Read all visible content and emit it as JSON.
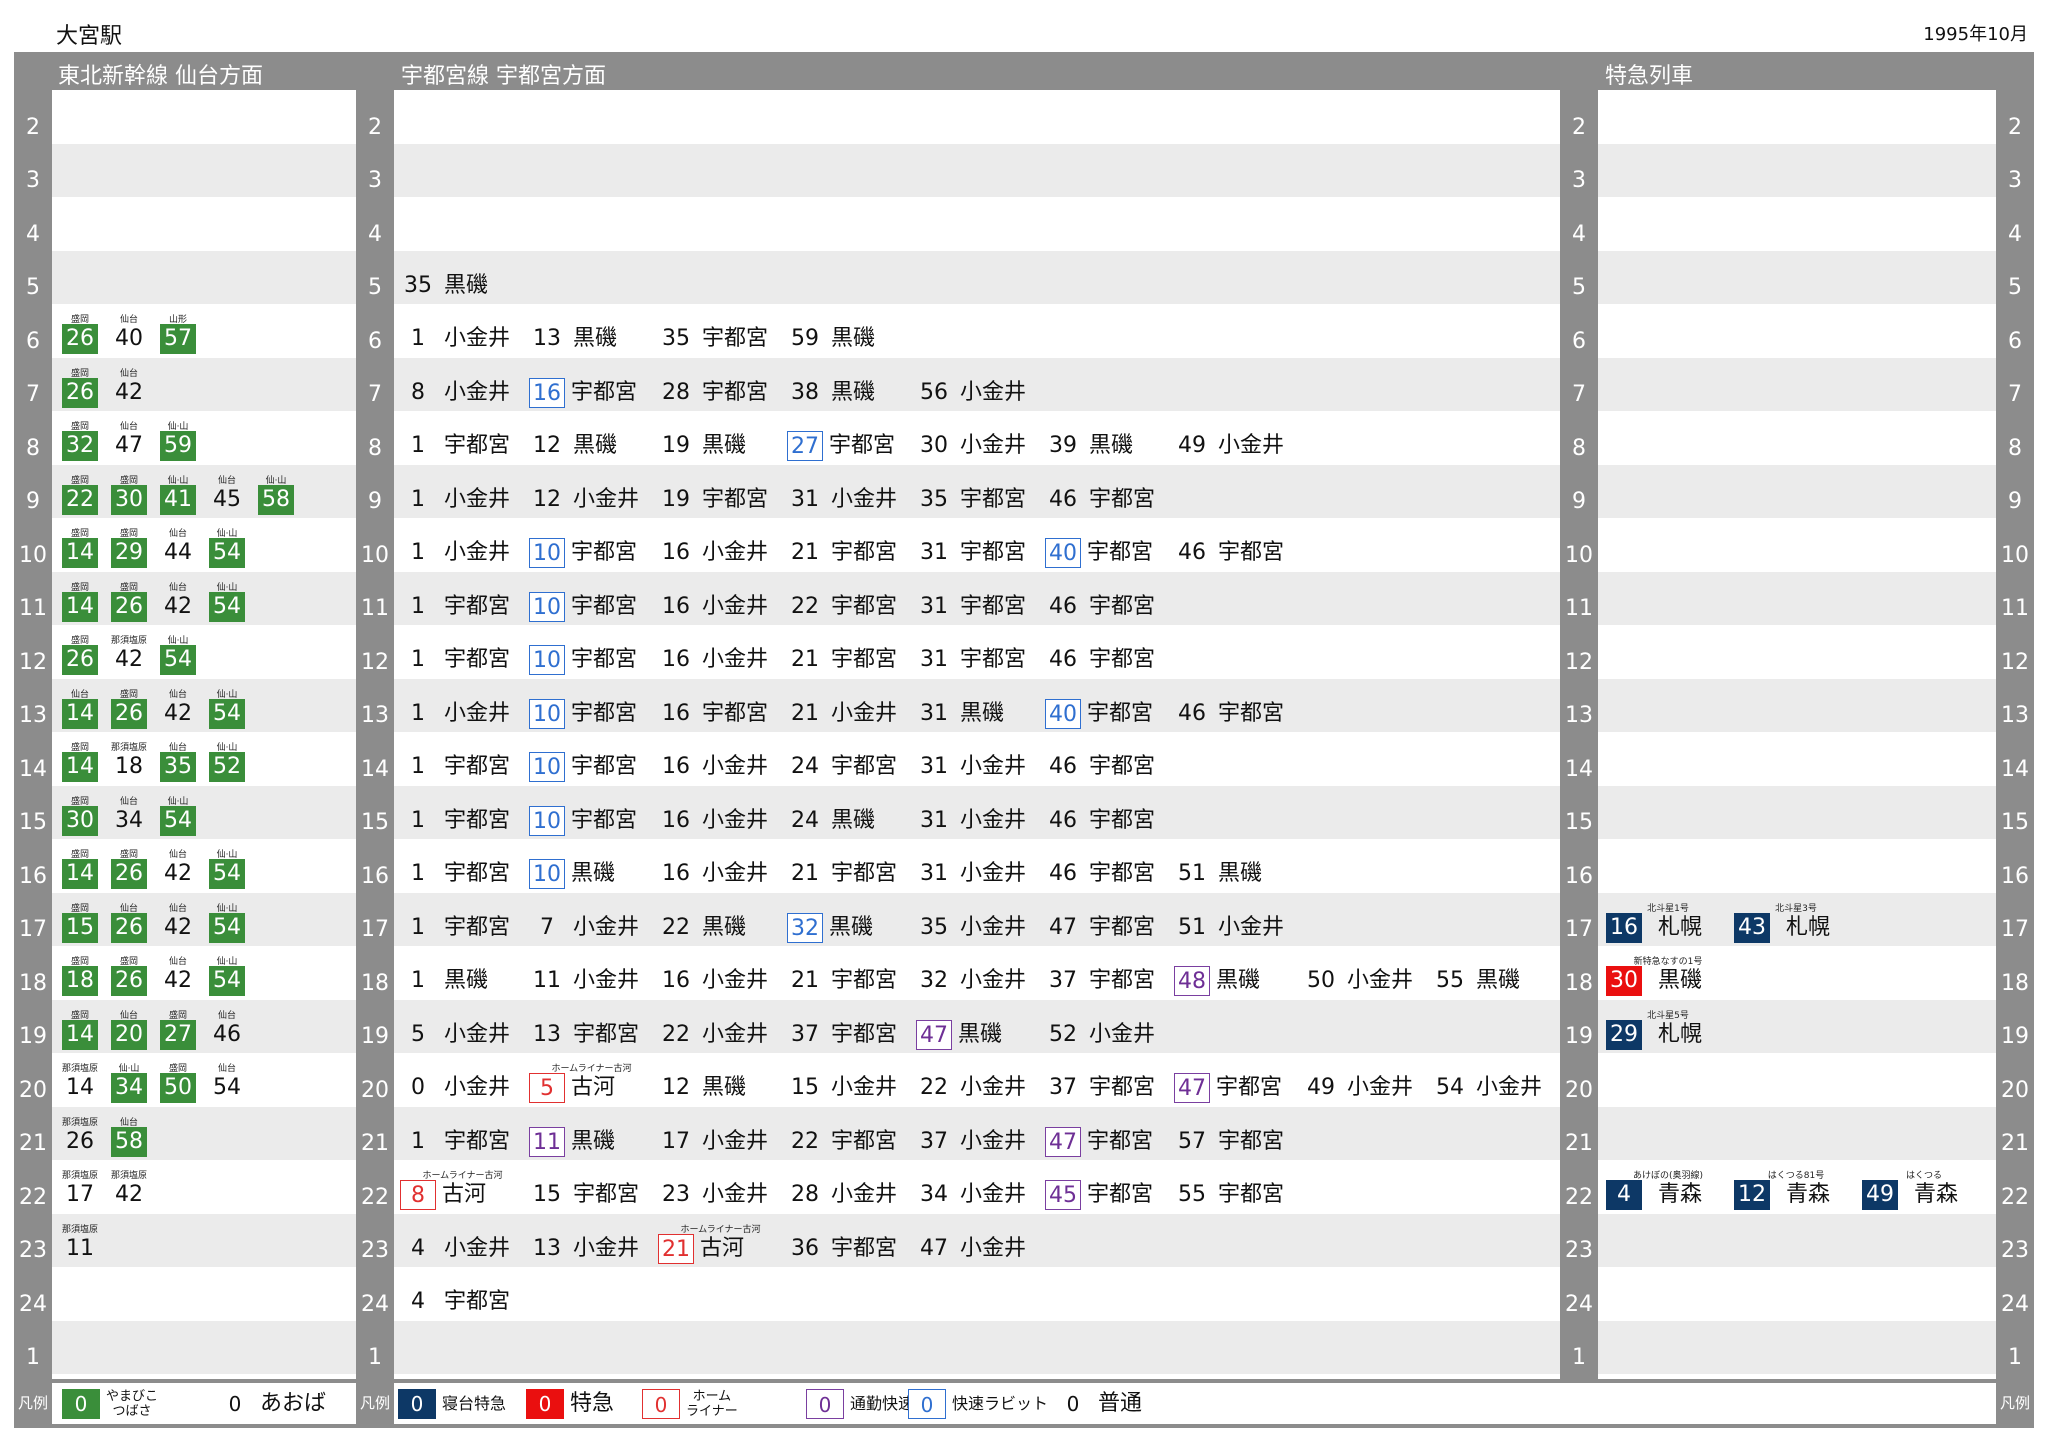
{
  "station": "大宮駅",
  "date": "1995年10月",
  "sections": {
    "shinkansen": "東北新幹線 仙台方面",
    "utsunomiya": "宇都宮線 宇都宮方面",
    "express": "特急列車"
  },
  "hours": [
    "2",
    "3",
    "4",
    "5",
    "6",
    "7",
    "8",
    "9",
    "10",
    "11",
    "12",
    "13",
    "14",
    "15",
    "16",
    "17",
    "18",
    "19",
    "20",
    "21",
    "22",
    "23",
    "24",
    "1"
  ],
  "legend": {
    "label": "凡例",
    "shinkansen": [
      {
        "min": "0",
        "style": "green",
        "text": "やまびこ\nつばさ"
      },
      {
        "min": "0",
        "style": "plain",
        "text": "あおば"
      }
    ],
    "utsunomiya": [
      {
        "min": "0",
        "style": "navy",
        "text": "寝台特急"
      },
      {
        "min": "0",
        "style": "red",
        "text": "特急"
      },
      {
        "min": "0",
        "style": "redo",
        "text": "ホーム\nライナー"
      },
      {
        "min": "0",
        "style": "purple",
        "text": "通勤快速"
      },
      {
        "min": "0",
        "style": "blue",
        "text": "快速ラビット"
      },
      {
        "min": "0",
        "style": "plain",
        "text": "普通"
      }
    ]
  },
  "shinkansen_rows": [
    [],
    [],
    [],
    [],
    [
      {
        "m": "26",
        "s": "green",
        "n": "盛岡"
      },
      {
        "m": "40",
        "s": "plain",
        "n": "仙台"
      },
      {
        "m": "57",
        "s": "green",
        "n": "山形"
      }
    ],
    [
      {
        "m": "26",
        "s": "green",
        "n": "盛岡"
      },
      {
        "m": "42",
        "s": "plain",
        "n": "仙台"
      }
    ],
    [
      {
        "m": "32",
        "s": "green",
        "n": "盛岡"
      },
      {
        "m": "47",
        "s": "plain",
        "n": "仙台"
      },
      {
        "m": "59",
        "s": "green",
        "n": "仙·山"
      }
    ],
    [
      {
        "m": "22",
        "s": "green",
        "n": "盛岡"
      },
      {
        "m": "30",
        "s": "green",
        "n": "盛岡"
      },
      {
        "m": "41",
        "s": "green",
        "n": "仙·山"
      },
      {
        "m": "45",
        "s": "plain",
        "n": "仙台"
      },
      {
        "m": "58",
        "s": "green",
        "n": "仙·山"
      }
    ],
    [
      {
        "m": "14",
        "s": "green",
        "n": "盛岡"
      },
      {
        "m": "29",
        "s": "green",
        "n": "盛岡"
      },
      {
        "m": "44",
        "s": "plain",
        "n": "仙台"
      },
      {
        "m": "54",
        "s": "green",
        "n": "仙·山"
      }
    ],
    [
      {
        "m": "14",
        "s": "green",
        "n": "盛岡"
      },
      {
        "m": "26",
        "s": "green",
        "n": "盛岡"
      },
      {
        "m": "42",
        "s": "plain",
        "n": "仙台"
      },
      {
        "m": "54",
        "s": "green",
        "n": "仙·山"
      }
    ],
    [
      {
        "m": "26",
        "s": "green",
        "n": "盛岡"
      },
      {
        "m": "42",
        "s": "plain",
        "n": "那須塩原"
      },
      {
        "m": "54",
        "s": "green",
        "n": "仙·山"
      }
    ],
    [
      {
        "m": "14",
        "s": "green",
        "n": "仙台"
      },
      {
        "m": "26",
        "s": "green",
        "n": "盛岡"
      },
      {
        "m": "42",
        "s": "plain",
        "n": "仙台"
      },
      {
        "m": "54",
        "s": "green",
        "n": "仙·山"
      }
    ],
    [
      {
        "m": "14",
        "s": "green",
        "n": "盛岡"
      },
      {
        "m": "18",
        "s": "plain",
        "n": "那須塩原"
      },
      {
        "m": "35",
        "s": "green",
        "n": "仙台"
      },
      {
        "m": "52",
        "s": "green",
        "n": "仙·山"
      }
    ],
    [
      {
        "m": "30",
        "s": "green",
        "n": "盛岡"
      },
      {
        "m": "34",
        "s": "plain",
        "n": "仙台"
      },
      {
        "m": "54",
        "s": "green",
        "n": "仙·山"
      }
    ],
    [
      {
        "m": "14",
        "s": "green",
        "n": "盛岡"
      },
      {
        "m": "26",
        "s": "green",
        "n": "盛岡"
      },
      {
        "m": "42",
        "s": "plain",
        "n": "仙台"
      },
      {
        "m": "54",
        "s": "green",
        "n": "仙·山"
      }
    ],
    [
      {
        "m": "15",
        "s": "green",
        "n": "盛岡"
      },
      {
        "m": "26",
        "s": "green",
        "n": "仙台"
      },
      {
        "m": "42",
        "s": "plain",
        "n": "仙台"
      },
      {
        "m": "54",
        "s": "green",
        "n": "仙·山"
      }
    ],
    [
      {
        "m": "18",
        "s": "green",
        "n": "盛岡"
      },
      {
        "m": "26",
        "s": "green",
        "n": "盛岡"
      },
      {
        "m": "42",
        "s": "plain",
        "n": "仙台"
      },
      {
        "m": "54",
        "s": "green",
        "n": "仙·山"
      }
    ],
    [
      {
        "m": "14",
        "s": "green",
        "n": "盛岡"
      },
      {
        "m": "20",
        "s": "green",
        "n": "仙台"
      },
      {
        "m": "27",
        "s": "green",
        "n": "盛岡"
      },
      {
        "m": "46",
        "s": "plain",
        "n": "仙台"
      }
    ],
    [
      {
        "m": "14",
        "s": "plain",
        "n": "那須塩原"
      },
      {
        "m": "34",
        "s": "green",
        "n": "仙·山"
      },
      {
        "m": "50",
        "s": "green",
        "n": "盛岡"
      },
      {
        "m": "54",
        "s": "plain",
        "n": "仙台"
      }
    ],
    [
      {
        "m": "26",
        "s": "plain",
        "n": "那須塩原"
      },
      {
        "m": "58",
        "s": "green",
        "n": "仙台"
      }
    ],
    [
      {
        "m": "17",
        "s": "plain",
        "n": "那須塩原"
      },
      {
        "m": "42",
        "s": "plain",
        "n": "那須塩原"
      }
    ],
    [
      {
        "m": "11",
        "s": "plain",
        "n": "那須塩原"
      }
    ],
    [],
    []
  ],
  "utsunomiya_rows": [
    [],
    [],
    [],
    [
      {
        "m": "35",
        "s": "plain",
        "d": "黒磯"
      }
    ],
    [
      {
        "m": "1",
        "s": "plain",
        "d": "小金井"
      },
      {
        "m": "13",
        "s": "plain",
        "d": "黒磯"
      },
      {
        "m": "35",
        "s": "plain",
        "d": "宇都宮"
      },
      {
        "m": "59",
        "s": "plain",
        "d": "黒磯"
      }
    ],
    [
      {
        "m": "8",
        "s": "plain",
        "d": "小金井"
      },
      {
        "m": "16",
        "s": "blue",
        "d": "宇都宮"
      },
      {
        "m": "28",
        "s": "plain",
        "d": "宇都宮"
      },
      {
        "m": "38",
        "s": "plain",
        "d": "黒磯"
      },
      {
        "m": "56",
        "s": "plain",
        "d": "小金井"
      }
    ],
    [
      {
        "m": "1",
        "s": "plain",
        "d": "宇都宮"
      },
      {
        "m": "12",
        "s": "plain",
        "d": "黒磯"
      },
      {
        "m": "19",
        "s": "plain",
        "d": "黒磯"
      },
      {
        "m": "27",
        "s": "blue",
        "d": "宇都宮"
      },
      {
        "m": "30",
        "s": "plain",
        "d": "小金井"
      },
      {
        "m": "39",
        "s": "plain",
        "d": "黒磯"
      },
      {
        "m": "49",
        "s": "plain",
        "d": "小金井"
      }
    ],
    [
      {
        "m": "1",
        "s": "plain",
        "d": "小金井"
      },
      {
        "m": "12",
        "s": "plain",
        "d": "小金井"
      },
      {
        "m": "19",
        "s": "plain",
        "d": "宇都宮"
      },
      {
        "m": "31",
        "s": "plain",
        "d": "小金井"
      },
      {
        "m": "35",
        "s": "plain",
        "d": "宇都宮"
      },
      {
        "m": "46",
        "s": "plain",
        "d": "宇都宮"
      }
    ],
    [
      {
        "m": "1",
        "s": "plain",
        "d": "小金井"
      },
      {
        "m": "10",
        "s": "blue",
        "d": "宇都宮"
      },
      {
        "m": "16",
        "s": "plain",
        "d": "小金井"
      },
      {
        "m": "21",
        "s": "plain",
        "d": "宇都宮"
      },
      {
        "m": "31",
        "s": "plain",
        "d": "宇都宮"
      },
      {
        "m": "40",
        "s": "blue",
        "d": "宇都宮"
      },
      {
        "m": "46",
        "s": "plain",
        "d": "宇都宮"
      }
    ],
    [
      {
        "m": "1",
        "s": "plain",
        "d": "宇都宮"
      },
      {
        "m": "10",
        "s": "blue",
        "d": "宇都宮"
      },
      {
        "m": "16",
        "s": "plain",
        "d": "小金井"
      },
      {
        "m": "22",
        "s": "plain",
        "d": "宇都宮"
      },
      {
        "m": "31",
        "s": "plain",
        "d": "宇都宮"
      },
      {
        "m": "46",
        "s": "plain",
        "d": "宇都宮"
      }
    ],
    [
      {
        "m": "1",
        "s": "plain",
        "d": "宇都宮"
      },
      {
        "m": "10",
        "s": "blue",
        "d": "宇都宮"
      },
      {
        "m": "16",
        "s": "plain",
        "d": "小金井"
      },
      {
        "m": "21",
        "s": "plain",
        "d": "宇都宮"
      },
      {
        "m": "31",
        "s": "plain",
        "d": "宇都宮"
      },
      {
        "m": "46",
        "s": "plain",
        "d": "宇都宮"
      }
    ],
    [
      {
        "m": "1",
        "s": "plain",
        "d": "小金井"
      },
      {
        "m": "10",
        "s": "blue",
        "d": "宇都宮"
      },
      {
        "m": "16",
        "s": "plain",
        "d": "宇都宮"
      },
      {
        "m": "21",
        "s": "plain",
        "d": "小金井"
      },
      {
        "m": "31",
        "s": "plain",
        "d": "黒磯"
      },
      {
        "m": "40",
        "s": "blue",
        "d": "宇都宮"
      },
      {
        "m": "46",
        "s": "plain",
        "d": "宇都宮"
      }
    ],
    [
      {
        "m": "1",
        "s": "plain",
        "d": "宇都宮"
      },
      {
        "m": "10",
        "s": "blue",
        "d": "宇都宮"
      },
      {
        "m": "16",
        "s": "plain",
        "d": "小金井"
      },
      {
        "m": "24",
        "s": "plain",
        "d": "宇都宮"
      },
      {
        "m": "31",
        "s": "plain",
        "d": "小金井"
      },
      {
        "m": "46",
        "s": "plain",
        "d": "宇都宮"
      }
    ],
    [
      {
        "m": "1",
        "s": "plain",
        "d": "宇都宮"
      },
      {
        "m": "10",
        "s": "blue",
        "d": "宇都宮"
      },
      {
        "m": "16",
        "s": "plain",
        "d": "小金井"
      },
      {
        "m": "24",
        "s": "plain",
        "d": "黒磯"
      },
      {
        "m": "31",
        "s": "plain",
        "d": "小金井"
      },
      {
        "m": "46",
        "s": "plain",
        "d": "宇都宮"
      }
    ],
    [
      {
        "m": "1",
        "s": "plain",
        "d": "宇都宮"
      },
      {
        "m": "10",
        "s": "blue",
        "d": "黒磯"
      },
      {
        "m": "16",
        "s": "plain",
        "d": "小金井"
      },
      {
        "m": "21",
        "s": "plain",
        "d": "宇都宮"
      },
      {
        "m": "31",
        "s": "plain",
        "d": "小金井"
      },
      {
        "m": "46",
        "s": "plain",
        "d": "宇都宮"
      },
      {
        "m": "51",
        "s": "plain",
        "d": "黒磯"
      }
    ],
    [
      {
        "m": "1",
        "s": "plain",
        "d": "宇都宮"
      },
      {
        "m": "7",
        "s": "plain",
        "d": "小金井"
      },
      {
        "m": "22",
        "s": "plain",
        "d": "黒磯"
      },
      {
        "m": "32",
        "s": "blue",
        "d": "黒磯"
      },
      {
        "m": "35",
        "s": "plain",
        "d": "小金井"
      },
      {
        "m": "47",
        "s": "plain",
        "d": "宇都宮"
      },
      {
        "m": "51",
        "s": "plain",
        "d": "小金井"
      }
    ],
    [
      {
        "m": "1",
        "s": "plain",
        "d": "黒磯"
      },
      {
        "m": "11",
        "s": "plain",
        "d": "小金井"
      },
      {
        "m": "16",
        "s": "plain",
        "d": "小金井"
      },
      {
        "m": "21",
        "s": "plain",
        "d": "宇都宮"
      },
      {
        "m": "32",
        "s": "plain",
        "d": "小金井"
      },
      {
        "m": "37",
        "s": "plain",
        "d": "宇都宮"
      },
      {
        "m": "48",
        "s": "purple",
        "d": "黒磯"
      },
      {
        "m": "50",
        "s": "plain",
        "d": "小金井"
      },
      {
        "m": "55",
        "s": "plain",
        "d": "黒磯"
      }
    ],
    [
      {
        "m": "5",
        "s": "plain",
        "d": "小金井"
      },
      {
        "m": "13",
        "s": "plain",
        "d": "宇都宮"
      },
      {
        "m": "22",
        "s": "plain",
        "d": "小金井"
      },
      {
        "m": "37",
        "s": "plain",
        "d": "宇都宮"
      },
      {
        "m": "47",
        "s": "purple",
        "d": "黒磯"
      },
      {
        "m": "52",
        "s": "plain",
        "d": "小金井"
      }
    ],
    [
      {
        "m": "0",
        "s": "plain",
        "d": "小金井"
      },
      {
        "m": "5",
        "s": "redo",
        "d": "古河",
        "n": "ホームライナー古河"
      },
      {
        "m": "12",
        "s": "plain",
        "d": "黒磯"
      },
      {
        "m": "15",
        "s": "plain",
        "d": "小金井"
      },
      {
        "m": "22",
        "s": "plain",
        "d": "小金井"
      },
      {
        "m": "37",
        "s": "plain",
        "d": "宇都宮"
      },
      {
        "m": "47",
        "s": "purple",
        "d": "宇都宮"
      },
      {
        "m": "49",
        "s": "plain",
        "d": "小金井"
      },
      {
        "m": "54",
        "s": "plain",
        "d": "小金井"
      }
    ],
    [
      {
        "m": "1",
        "s": "plain",
        "d": "宇都宮"
      },
      {
        "m": "11",
        "s": "purple",
        "d": "黒磯"
      },
      {
        "m": "17",
        "s": "plain",
        "d": "小金井"
      },
      {
        "m": "22",
        "s": "plain",
        "d": "宇都宮"
      },
      {
        "m": "37",
        "s": "plain",
        "d": "小金井"
      },
      {
        "m": "47",
        "s": "purple",
        "d": "宇都宮"
      },
      {
        "m": "57",
        "s": "plain",
        "d": "宇都宮"
      }
    ],
    [
      {
        "m": "8",
        "s": "redo",
        "d": "古河",
        "n": "ホームライナー古河"
      },
      {
        "m": "15",
        "s": "plain",
        "d": "宇都宮"
      },
      {
        "m": "23",
        "s": "plain",
        "d": "小金井"
      },
      {
        "m": "28",
        "s": "plain",
        "d": "小金井"
      },
      {
        "m": "34",
        "s": "plain",
        "d": "小金井"
      },
      {
        "m": "45",
        "s": "purple",
        "d": "宇都宮"
      },
      {
        "m": "55",
        "s": "plain",
        "d": "宇都宮"
      }
    ],
    [
      {
        "m": "4",
        "s": "plain",
        "d": "小金井"
      },
      {
        "m": "13",
        "s": "plain",
        "d": "小金井"
      },
      {
        "m": "21",
        "s": "redo",
        "d": "古河",
        "n": "ホームライナー古河"
      },
      {
        "m": "36",
        "s": "plain",
        "d": "宇都宮"
      },
      {
        "m": "47",
        "s": "plain",
        "d": "小金井"
      }
    ],
    [
      {
        "m": "4",
        "s": "plain",
        "d": "宇都宮"
      }
    ],
    []
  ],
  "express_rows": [
    [],
    [],
    [],
    [],
    [],
    [],
    [],
    [],
    [],
    [],
    [],
    [],
    [],
    [],
    [],
    [
      {
        "m": "16",
        "s": "navy",
        "d": "札幌",
        "n": "北斗星1号"
      },
      {
        "m": "43",
        "s": "navy",
        "d": "札幌",
        "n": "北斗星3号"
      }
    ],
    [
      {
        "m": "30",
        "s": "red",
        "d": "黒磯",
        "n": "新特急なすの1号"
      }
    ],
    [
      {
        "m": "29",
        "s": "navy",
        "d": "札幌",
        "n": "北斗星5号"
      }
    ],
    [],
    [],
    [
      {
        "m": "4",
        "s": "navy",
        "d": "青森",
        "n": "あけぼの(奥羽線)"
      },
      {
        "m": "12",
        "s": "navy",
        "d": "青森",
        "n": "はくつる81号"
      },
      {
        "m": "49",
        "s": "navy",
        "d": "青森",
        "n": "はくつる"
      }
    ],
    [],
    [],
    []
  ]
}
